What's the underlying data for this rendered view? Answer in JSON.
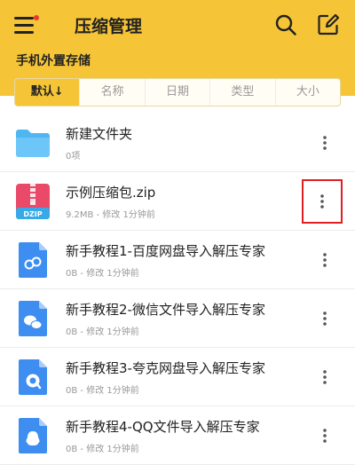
{
  "header": {
    "title": "压缩管理",
    "section": "手机外置存储",
    "accent": "#f6c537",
    "notification_dot": "#e53935"
  },
  "sort_tabs": [
    {
      "label": "默认↓",
      "active": true
    },
    {
      "label": "名称",
      "active": false
    },
    {
      "label": "日期",
      "active": false
    },
    {
      "label": "类型",
      "active": false
    },
    {
      "label": "大小",
      "active": false
    }
  ],
  "files": [
    {
      "name": "新建文件夹",
      "sub": "0项",
      "icon": "folder-icon"
    },
    {
      "name": "示例压缩包.zip",
      "sub": "9.2MB - 修改 1分钟前",
      "icon": "dzip-icon",
      "zip_label": "DZIP"
    },
    {
      "name": "新手教程1-百度网盘导入解压专家",
      "sub": "0B - 修改 1分钟前",
      "icon": "baidu-doc-icon"
    },
    {
      "name": "新手教程2-微信文件导入解压专家",
      "sub": "0B - 修改 1分钟前",
      "icon": "wechat-doc-icon"
    },
    {
      "name": "新手教程3-夸克网盘导入解压专家",
      "sub": "0B - 修改 1分钟前",
      "icon": "quark-doc-icon"
    },
    {
      "name": "新手教程4-QQ文件导入解压专家",
      "sub": "0B - 修改 1分钟前",
      "icon": "qq-doc-icon"
    }
  ]
}
